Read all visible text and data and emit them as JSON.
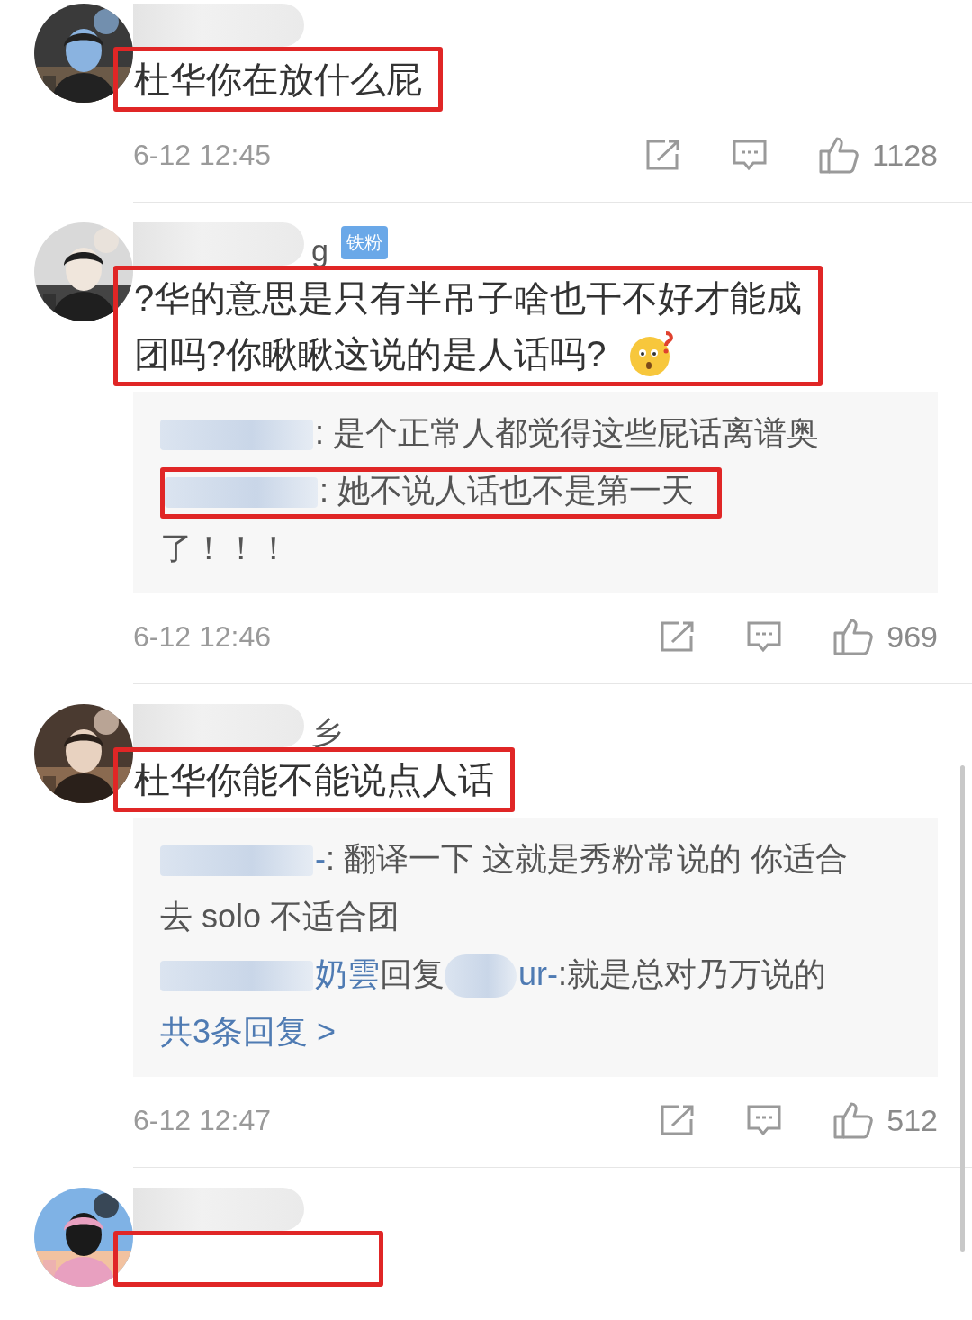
{
  "comments": [
    {
      "text": "杜华你在放什么屁",
      "highlighted": true,
      "time": "6-12 12:45",
      "likes": "1128"
    },
    {
      "name_tail": "g",
      "badge": "铁粉",
      "text": "?华的意思是只有半吊子啥也干不好才能成",
      "continuation": "团吗?你瞅瞅这说的是人话吗?",
      "highlighted": true,
      "emoji": true,
      "replies": [
        {
          "kind": "reply",
          "text": ": 是个正常人都觉得这些屁话离谱奥"
        },
        {
          "kind": "reply",
          "text": ": 她不说人话也不是第一天",
          "highlighted": true,
          "continuation": "了！！！"
        }
      ],
      "time": "6-12 12:46",
      "likes": "969"
    },
    {
      "name_tail": "乡",
      "text": "杜华你能不能说点人话",
      "highlighted": true,
      "replies": [
        {
          "kind": "reply",
          "name_tail": "-",
          "text": ": 翻译一下 这就是秀粉常说的 你适合",
          "continuation": "去 solo 不适合团"
        },
        {
          "kind": "reply-to",
          "name_tail": "奶雲",
          "verb": "回复",
          "target_tail": "ur-",
          "text": ":就是总对乃万说的"
        }
      ],
      "more_link": "共3条回复 >",
      "time": "6-12 12:47",
      "likes": "512"
    },
    {
      "highlighted": true
    }
  ]
}
